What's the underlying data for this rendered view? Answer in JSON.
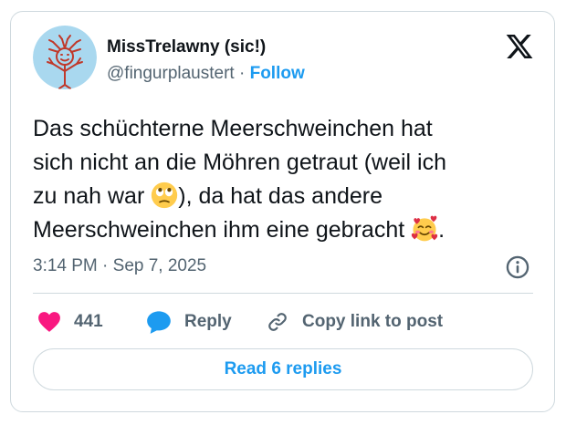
{
  "author": {
    "name": "MissTrelawny (sic!)",
    "handle": "@fingurplaustert",
    "separator": "·",
    "follow_label": "Follow",
    "avatar_icon": "drawn-figure-avatar-icon"
  },
  "brand_icon": "x-logo-icon",
  "tweet": {
    "line1": "Das schüchterne Meerschweinchen hat",
    "line2": "sich nicht an die Möhren getraut (weil ich",
    "line3_pre": "zu nah war ",
    "line3_post": "), da hat das andere",
    "line4_pre": "Meerschweinchen ihm eine gebracht ",
    "line4_post": ".",
    "emoji_1": "face-with-rolling-eyes-emoji",
    "emoji_2": "smiling-face-with-hearts-emoji"
  },
  "timestamp": "3:14 PM · Sep 7, 2025",
  "info_icon": "info-icon",
  "actions": {
    "like_count": "441",
    "reply_label": "Reply",
    "copy_label": "Copy link to post"
  },
  "read_replies_label": "Read 6 replies",
  "colors": {
    "accent": "#1d9bf0",
    "heart": "#f91880",
    "muted": "#536471",
    "border": "#cfd9de"
  }
}
